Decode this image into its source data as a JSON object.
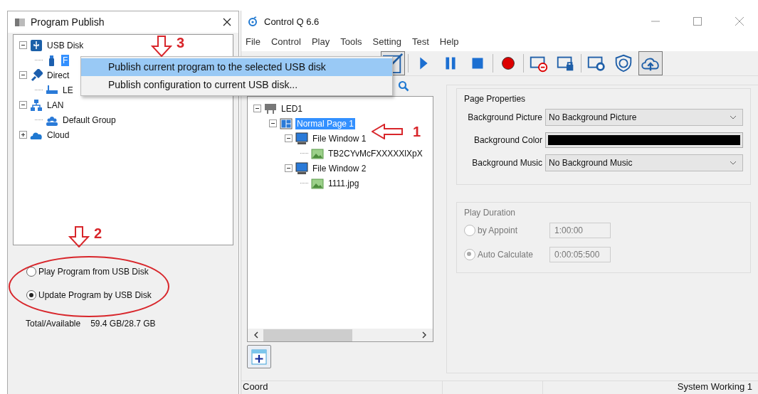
{
  "publish_dialog": {
    "title": "Program Publish",
    "tree": [
      {
        "label": "USB Disk",
        "kind": "usb",
        "expanded": true,
        "selected": false,
        "children": [
          {
            "label": "F",
            "kind": "usb-stick",
            "selected": true
          }
        ]
      },
      {
        "label": "Direct",
        "kind": "cable",
        "expanded": true,
        "selected": false,
        "children": [
          {
            "label": "LE",
            "kind": "led",
            "selected": false
          }
        ]
      },
      {
        "label": "LAN",
        "kind": "lan",
        "expanded": true,
        "selected": false,
        "children": [
          {
            "label": "Default Group",
            "kind": "group",
            "selected": false
          }
        ]
      },
      {
        "label": "Cloud",
        "kind": "cloud",
        "expanded": false,
        "selected": false
      }
    ],
    "options": [
      {
        "label": "Play Program from USB Disk",
        "selected": false
      },
      {
        "label": "Update Program by USB Disk",
        "selected": true
      }
    ],
    "capacity_label": "Total/Available",
    "capacity_value": "59.4 GB/28.7 GB"
  },
  "context_menu": {
    "items": [
      {
        "label": "Publish current program to the selected USB disk",
        "selected": true
      },
      {
        "label": "Publish configuration to current USB disk...",
        "selected": false
      }
    ]
  },
  "main_window": {
    "title": "Control Q 6.6",
    "menu": [
      "File",
      "Control",
      "Play",
      "Tools",
      "Setting",
      "Test",
      "Help"
    ],
    "toolbar": [
      {
        "kind": "edit",
        "pressed": true
      },
      {
        "kind": "separator"
      },
      {
        "kind": "play",
        "pressed": false
      },
      {
        "kind": "pause",
        "pressed": false
      },
      {
        "kind": "stop",
        "pressed": false
      },
      {
        "kind": "separator"
      },
      {
        "kind": "record",
        "pressed": false
      },
      {
        "kind": "separator"
      },
      {
        "kind": "screen-minus",
        "pressed": false
      },
      {
        "kind": "screen-lock",
        "pressed": false
      },
      {
        "kind": "separator"
      },
      {
        "kind": "screen-gear",
        "pressed": false
      },
      {
        "kind": "shield",
        "pressed": false
      },
      {
        "kind": "cloud-upload",
        "pressed": true
      }
    ],
    "program_tree": [
      {
        "label": "LED1",
        "kind": "led",
        "expanded": true,
        "selected": false,
        "children": [
          {
            "label": "Normal Page 1",
            "kind": "page",
            "expanded": true,
            "selected": true,
            "children": [
              {
                "label": "File Window 1",
                "kind": "window",
                "expanded": true,
                "selected": false,
                "children": [
                  {
                    "label": "TB2CYvMcFXXXXXlXpX",
                    "kind": "image",
                    "selected": false
                  }
                ]
              },
              {
                "label": "File Window 2",
                "kind": "window",
                "expanded": true,
                "selected": false,
                "children": [
                  {
                    "label": "1111.jpg",
                    "kind": "image",
                    "selected": false
                  }
                ]
              }
            ]
          }
        ]
      }
    ],
    "page_properties": {
      "title": "Page Properties",
      "background_picture": {
        "label": "Background Picture",
        "value": "No Background Picture"
      },
      "background_color": {
        "label": "Background Color",
        "color": "#000000"
      },
      "background_music": {
        "label": "Background Music",
        "value": "No Background Music"
      }
    },
    "play_duration": {
      "title": "Play Duration",
      "disabled": true,
      "options": [
        {
          "label": "by Appoint",
          "selected": false,
          "value": "1:00:00"
        },
        {
          "label": "Auto Calculate",
          "selected": true,
          "value": "0:00:05:500"
        }
      ]
    },
    "status_bar": {
      "coord": "Coord",
      "status": "System Working 1"
    }
  },
  "annotations": [
    {
      "label": "3",
      "kind": "arrow-down"
    },
    {
      "label": "2",
      "kind": "arrow-down"
    },
    {
      "label": "1",
      "kind": "arrow-left"
    }
  ]
}
